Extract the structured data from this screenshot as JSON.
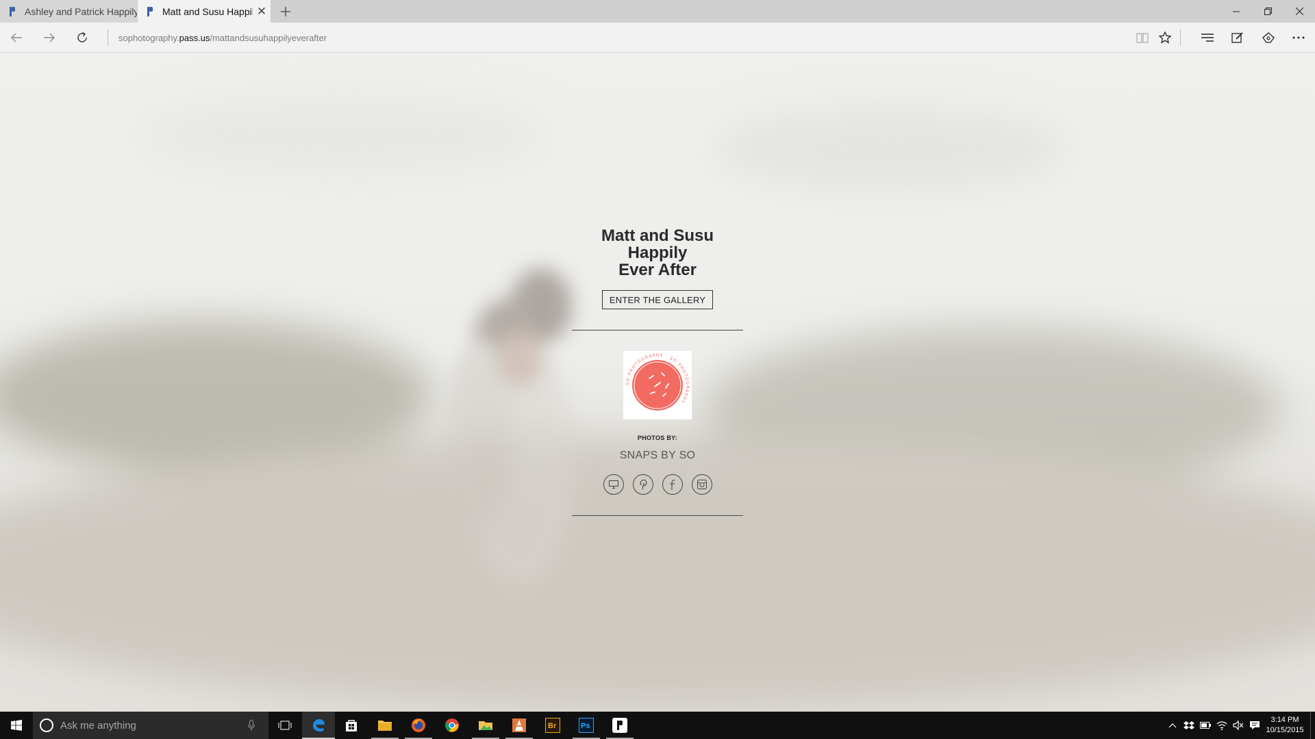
{
  "browser": {
    "tabs": [
      {
        "title": "Ashley and Patrick Happily E",
        "active": false
      },
      {
        "title": "Matt and Susu Happily E",
        "active": true
      }
    ],
    "new_tab_icon": "plus-icon",
    "address": {
      "prefix": "sophotography.",
      "host": "pass.us",
      "path": "/mattandsusuhappilyeverafter"
    }
  },
  "page": {
    "title_line1": "Matt and Susu Happily",
    "title_line2": "Ever After",
    "enter_label": "ENTER THE GALLERY",
    "photos_by_label": "PHOTOS BY:",
    "photographer": "SNAPS BY SO",
    "logo_ring_text": "SO PHOTOGRAPHY · SO PHOTOGRAPHY · ",
    "logo_color": "#f26b62",
    "socials": [
      "website-icon",
      "pinterest-icon",
      "facebook-icon",
      "instagram-icon"
    ]
  },
  "taskbar": {
    "search_placeholder": "Ask me anything",
    "time": "3:14 PM",
    "date": "10/15/2015"
  }
}
